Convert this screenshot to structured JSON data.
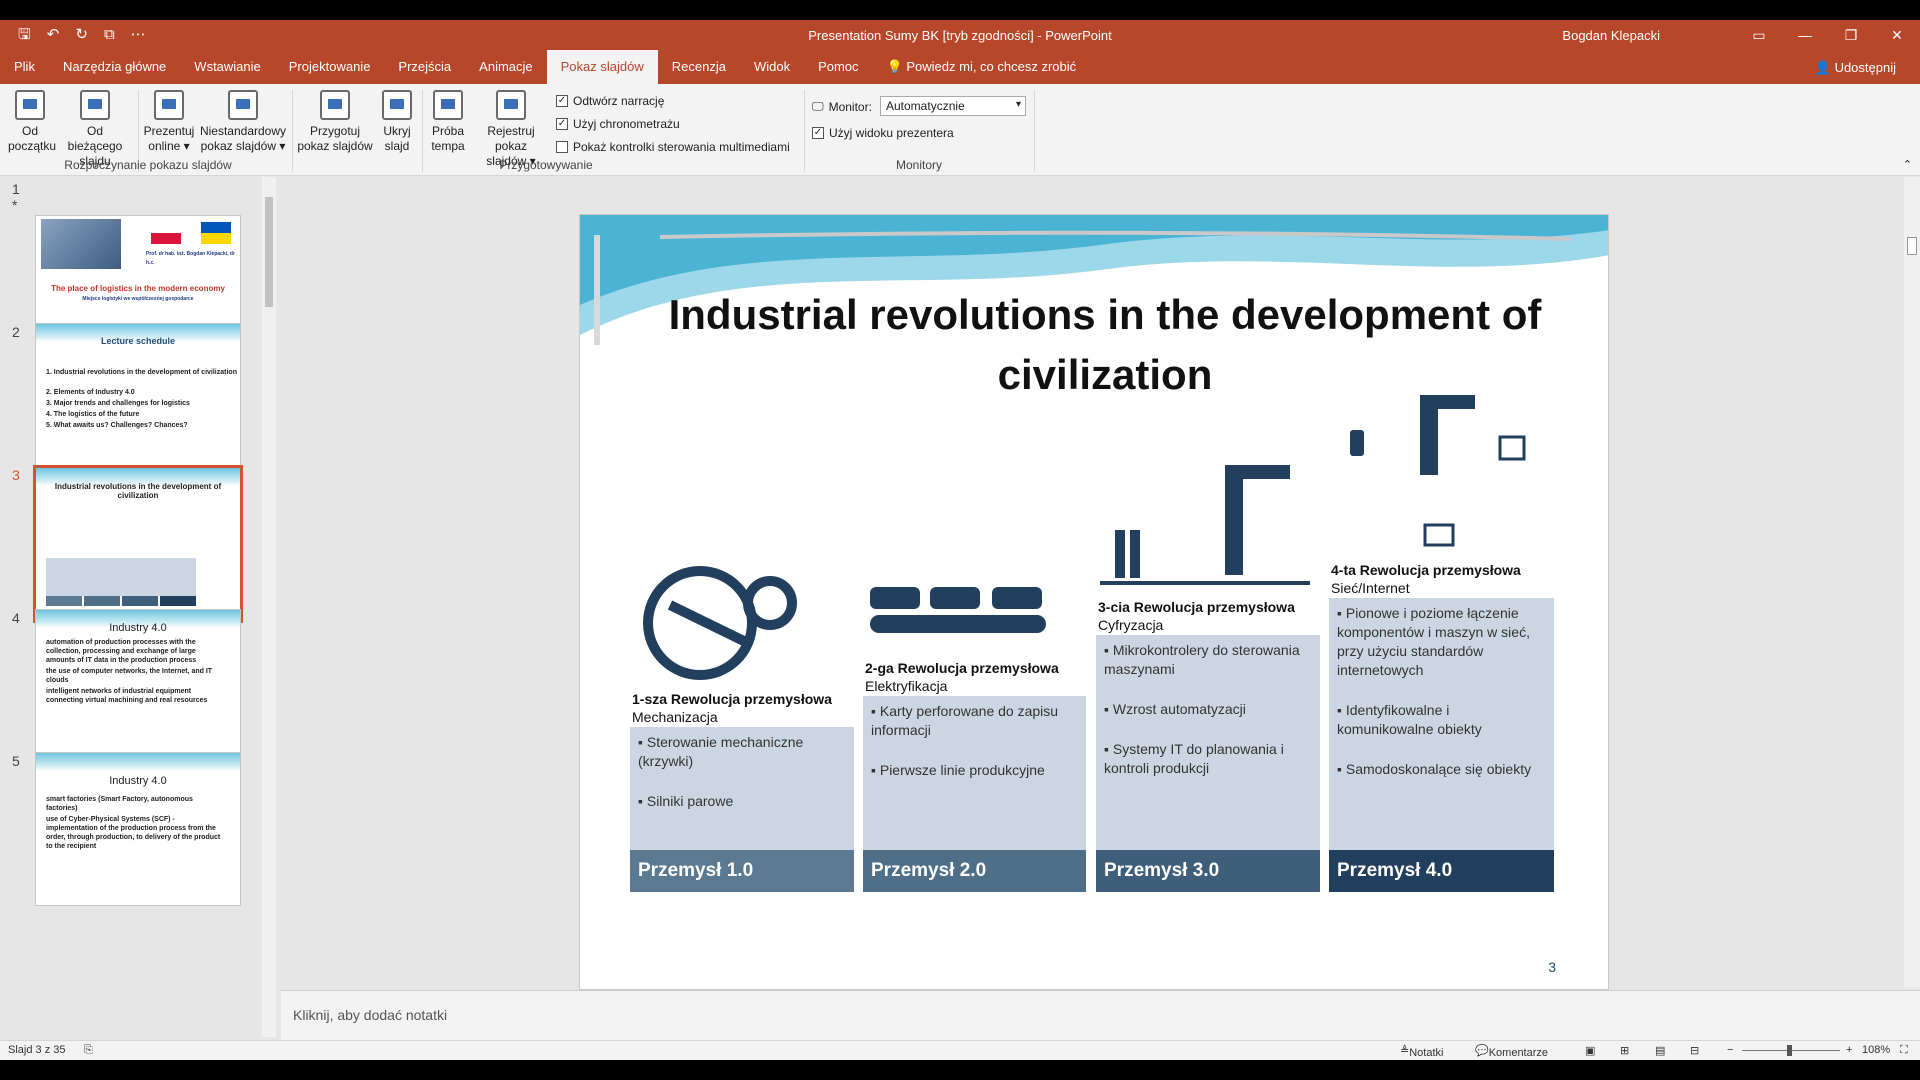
{
  "window": {
    "title": "Presentation Sumy BK [tryb zgodności]  -  PowerPoint",
    "user": "Bogdan Klepacki"
  },
  "tabs": [
    "Plik",
    "Narzędzia główne",
    "Wstawianie",
    "Projektowanie",
    "Przejścia",
    "Animacje",
    "Pokaz slajdów",
    "Recenzja",
    "Widok",
    "Pomoc"
  ],
  "tell_me": "Powiedz mi, co chcesz zrobić",
  "share": "Udostępnij",
  "ribbon": {
    "from_start": [
      "Od",
      "początku"
    ],
    "from_current": [
      "Od bieżącego",
      "slajdu"
    ],
    "present_online": [
      "Prezentuj",
      "online ▾"
    ],
    "custom_show": [
      "Niestandardowy",
      "pokaz slajdów ▾"
    ],
    "group_start": "Rozpoczynanie pokazu slajdów",
    "setup_show": [
      "Przygotuj",
      "pokaz slajdów"
    ],
    "hide_slide": [
      "Ukryj",
      "slajd"
    ],
    "rehearse": [
      "Próba",
      "tempa"
    ],
    "record": [
      "Rejestruj pokaz",
      "slajdów ▾"
    ],
    "group_setup": "Przygotowywanie",
    "play_narrations": "Odtwórz narrację",
    "use_timings": "Użyj chronometrażu",
    "show_media_controls": "Pokaż kontrolki sterowania multimediami",
    "monitor_label": "Monitor:",
    "monitor_value": "Automatycznie",
    "presenter_view": "Użyj widoku prezentera",
    "group_monitors": "Monitory"
  },
  "thumbnails": [
    {
      "num": "1",
      "title": "The place of logistics in the modern economy",
      "sub": "Miejsce logistyki we współczesnej gospodarce",
      "extra": "Prof. dr hab. inż. Bogdan Klepacki, dr h.c."
    },
    {
      "num": "2",
      "title": "Lecture schedule",
      "items": [
        "1.  Industrial revolutions in the development of civilization",
        "2.  Elements of Industry 4.0",
        "3.  Major trends and challenges for logistics",
        "4.  The logistics of the future",
        "5.  What awaits us? Challenges? Chances?"
      ]
    },
    {
      "num": "3",
      "title": "Industrial revolutions in the development of civilization"
    },
    {
      "num": "4",
      "title": "Industry 4.0",
      "items": [
        "automation of production processes with the collection, processing and exchange of large amounts of IT data in the production process",
        "the use of computer networks, the Internet, and IT clouds",
        "intelligent networks of industrial equipment connecting virtual machining and real resources"
      ]
    },
    {
      "num": "5",
      "title": "Industry 4.0",
      "items": [
        "smart factories (Smart Factory, autonomous factories)",
        "use of Cyber-Physical Systems (SCF) - implementation of the production process from the order, through production, to delivery of the product to the recipient"
      ]
    }
  ],
  "slide": {
    "title": "Industrial revolutions in the development of civilization",
    "page": "3",
    "columns": [
      {
        "head": "1-sza Rewolucja przemysłowa",
        "sub": "Mechanizacja",
        "items": [
          "Sterowanie mechaniczne (krzywki)",
          "Silniki parowe"
        ],
        "foot": "Przemysł 1.0",
        "color": "#5b7a92"
      },
      {
        "head": "2-ga Rewolucja przemysłowa",
        "sub": "Elektryfikacja",
        "items": [
          "Karty perforowane do zapisu informacji",
          "Pierwsze linie produkcyjne"
        ],
        "foot": "Przemysł 2.0",
        "color": "#4f6f88"
      },
      {
        "head": "3-cia Rewolucja przemysłowa",
        "sub": "Cyfryzacja",
        "items": [
          "Mikrokontrolery do sterowania maszynami",
          "Wzrost automatyzacji",
          "Systemy IT do planowania i kontroli produkcji"
        ],
        "foot": "Przemysł 3.0",
        "color": "#3f5e79"
      },
      {
        "head": "4-ta Rewolucja przemysłowa",
        "sub": "Sieć/Internet",
        "items": [
          "Pionowe i poziome łączenie komponentów i maszyn w sieć, przy użyciu standardów internetowych",
          "Identyfikowalne i komunikowalne obiekty",
          "Samodoskonalące się obiekty"
        ],
        "foot": "Przemysł 4.0",
        "color": "#223f5e"
      }
    ]
  },
  "notes_placeholder": "Kliknij, aby dodać notatki",
  "status": {
    "slide_count": "Slajd 3 z 35",
    "notes": "Notatki",
    "comments": "Komentarze",
    "zoom": "108%"
  }
}
